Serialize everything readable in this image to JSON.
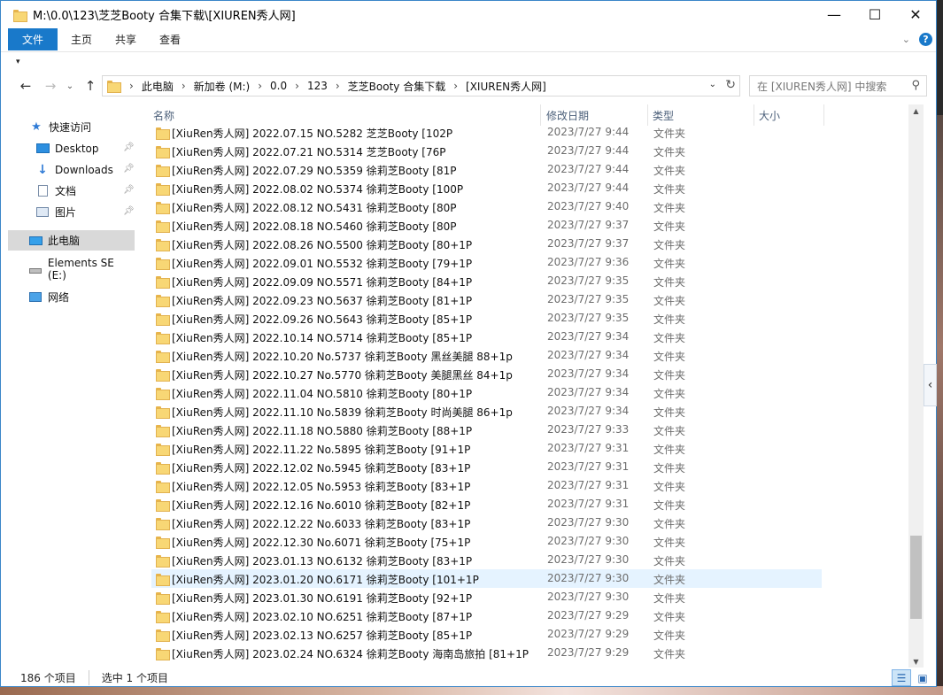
{
  "window": {
    "title": "M:\\0.0\\123\\芝芝Booty 合集下载\\[XIUREN秀人网]",
    "controls": {
      "minimize": "—",
      "maximize": "☐",
      "close": "✕"
    }
  },
  "ribbon": {
    "file": "文件",
    "tabs": [
      "主页",
      "共享",
      "查看"
    ],
    "help": "?"
  },
  "address": {
    "crumbs": [
      "此电脑",
      "新加卷 (M:)",
      "0.0",
      "123",
      "芝芝Booty 合集下载",
      "[XIUREN秀人网]"
    ]
  },
  "search": {
    "placeholder": "在 [XIUREN秀人网] 中搜索"
  },
  "nav": {
    "quick_access": "快速访问",
    "desktop": "Desktop",
    "downloads": "Downloads",
    "documents": "文档",
    "pictures": "图片",
    "this_pc": "此电脑",
    "drive": "Elements SE (E:)",
    "network": "网络"
  },
  "columns": {
    "name": "名称",
    "date": "修改日期",
    "type": "类型",
    "size": "大小"
  },
  "files": [
    {
      "name": "[XiuRen秀人网] 2022.07.15 NO.5282 芝芝Booty [102P",
      "date": "2023/7/27 9:44",
      "type": "文件夹"
    },
    {
      "name": "[XiuRen秀人网] 2022.07.21 NO.5314 芝芝Booty [76P",
      "date": "2023/7/27 9:44",
      "type": "文件夹"
    },
    {
      "name": "[XiuRen秀人网] 2022.07.29 NO.5359 徐莉芝Booty [81P",
      "date": "2023/7/27 9:44",
      "type": "文件夹"
    },
    {
      "name": "[XiuRen秀人网] 2022.08.02 NO.5374 徐莉芝Booty [100P",
      "date": "2023/7/27 9:44",
      "type": "文件夹"
    },
    {
      "name": "[XiuRen秀人网] 2022.08.12 NO.5431 徐莉芝Booty [80P",
      "date": "2023/7/27 9:40",
      "type": "文件夹"
    },
    {
      "name": "[XiuRen秀人网] 2022.08.18 NO.5460 徐莉芝Booty [80P",
      "date": "2023/7/27 9:37",
      "type": "文件夹"
    },
    {
      "name": "[XiuRen秀人网] 2022.08.26 NO.5500 徐莉芝Booty [80+1P",
      "date": "2023/7/27 9:37",
      "type": "文件夹"
    },
    {
      "name": "[XiuRen秀人网] 2022.09.01 NO.5532 徐莉芝Booty [79+1P",
      "date": "2023/7/27 9:36",
      "type": "文件夹"
    },
    {
      "name": "[XiuRen秀人网] 2022.09.09 NO.5571 徐莉芝Booty  [84+1P",
      "date": "2023/7/27 9:35",
      "type": "文件夹"
    },
    {
      "name": "[XiuRen秀人网] 2022.09.23 NO.5637 徐莉芝Booty [81+1P",
      "date": "2023/7/27 9:35",
      "type": "文件夹"
    },
    {
      "name": "[XiuRen秀人网] 2022.09.26 NO.5643 徐莉芝Booty [85+1P",
      "date": "2023/7/27 9:35",
      "type": "文件夹"
    },
    {
      "name": "[XiuRen秀人网] 2022.10.14 NO.5714 徐莉芝Booty [85+1P",
      "date": "2023/7/27 9:34",
      "type": "文件夹"
    },
    {
      "name": "[XiuRen秀人网] 2022.10.20 No.5737 徐莉芝Booty 黑丝美腿 88+1p",
      "date": "2023/7/27 9:34",
      "type": "文件夹"
    },
    {
      "name": "[XiuRen秀人网] 2022.10.27 No.5770 徐莉芝Booty 美腿黑丝 84+1p",
      "date": "2023/7/27 9:34",
      "type": "文件夹"
    },
    {
      "name": "[XiuRen秀人网] 2022.11.04 NO.5810 徐莉芝Booty [80+1P",
      "date": "2023/7/27 9:34",
      "type": "文件夹"
    },
    {
      "name": "[XiuRen秀人网] 2022.11.10 No.5839 徐莉芝Booty 时尚美腿 86+1p",
      "date": "2023/7/27 9:34",
      "type": "文件夹"
    },
    {
      "name": "[XiuRen秀人网] 2022.11.18 NO.5880 徐莉芝Booty  [88+1P",
      "date": "2023/7/27 9:33",
      "type": "文件夹"
    },
    {
      "name": "[XiuRen秀人网] 2022.11.22 No.5895 徐莉芝Booty [91+1P",
      "date": "2023/7/27 9:31",
      "type": "文件夹"
    },
    {
      "name": "[XiuRen秀人网] 2022.12.02 No.5945 徐莉芝Booty [83+1P",
      "date": "2023/7/27 9:31",
      "type": "文件夹"
    },
    {
      "name": "[XiuRen秀人网] 2022.12.05 No.5953 徐莉芝Booty [83+1P",
      "date": "2023/7/27 9:31",
      "type": "文件夹"
    },
    {
      "name": "[XiuRen秀人网] 2022.12.16 No.6010 徐莉芝Booty [82+1P",
      "date": "2023/7/27 9:31",
      "type": "文件夹"
    },
    {
      "name": "[XiuRen秀人网] 2022.12.22 No.6033 徐莉芝Booty [83+1P",
      "date": "2023/7/27 9:30",
      "type": "文件夹"
    },
    {
      "name": "[XiuRen秀人网] 2022.12.30 No.6071 徐莉芝Booty [75+1P",
      "date": "2023/7/27 9:30",
      "type": "文件夹"
    },
    {
      "name": "[XiuRen秀人网] 2023.01.13 NO.6132 徐莉芝Booty [83+1P",
      "date": "2023/7/27 9:30",
      "type": "文件夹"
    },
    {
      "name": "[XiuRen秀人网] 2023.01.20 NO.6171 徐莉芝Booty [101+1P",
      "date": "2023/7/27 9:30",
      "type": "文件夹",
      "selected": true
    },
    {
      "name": "[XiuRen秀人网] 2023.01.30 NO.6191 徐莉芝Booty [92+1P",
      "date": "2023/7/27 9:30",
      "type": "文件夹"
    },
    {
      "name": "[XiuRen秀人网] 2023.02.10 NO.6251 徐莉芝Booty [87+1P",
      "date": "2023/7/27 9:29",
      "type": "文件夹"
    },
    {
      "name": "[XiuRen秀人网] 2023.02.13 NO.6257 徐莉芝Booty [85+1P",
      "date": "2023/7/27 9:29",
      "type": "文件夹"
    },
    {
      "name": "[XiuRen秀人网] 2023.02.24 NO.6324 徐莉芝Booty 海南岛旅拍 [81+1P",
      "date": "2023/7/27 9:29",
      "type": "文件夹"
    }
  ],
  "status": {
    "count": "186 个项目",
    "selected": "选中 1 个项目"
  },
  "colors": {
    "accent": "#1979ca",
    "selection": "#e5f3ff",
    "folder": "#f8d775"
  }
}
